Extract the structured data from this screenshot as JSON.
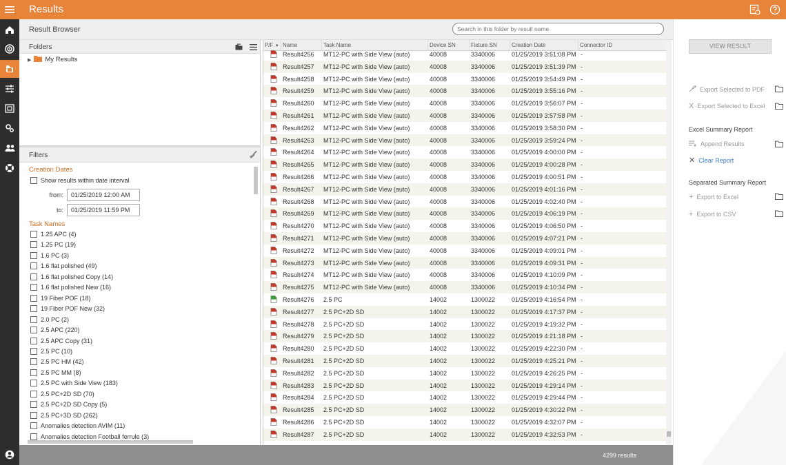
{
  "app": {
    "title": "Results"
  },
  "header": {
    "title": "Result Browser",
    "search_placeholder": "Search in this folder by result name"
  },
  "rail": {
    "icons": [
      "home-icon",
      "target-icon",
      "results-icon",
      "sliders-icon",
      "gallery-icon",
      "settings-icon",
      "users-icon",
      "help-ring-icon",
      "account-icon"
    ],
    "active": "results-icon"
  },
  "folders": {
    "title": "Folders",
    "tree": [
      {
        "label": "My Results"
      }
    ]
  },
  "filters": {
    "title": "Filters",
    "creation_dates": {
      "title": "Creation Dates",
      "interval_label": "Show results within date interval",
      "from_label": "from:",
      "from_value": "01/25/2019 12:00 AM",
      "to_label": "to:",
      "to_value": "01/25/2019 11:59 PM"
    },
    "task_names_title": "Task Names",
    "task_names": [
      "1.25 APC (4)",
      "1.25 PC (19)",
      "1.6 PC (3)",
      "1.6 flat polished (49)",
      "1.6 flat polished Copy (14)",
      "1.6 flat polished New (16)",
      "19 Fiber POF (18)",
      "19 Fiber POF New (32)",
      "2.0 PC (2)",
      "2.5 APC (220)",
      "2.5 APC Copy (31)",
      "2.5 PC (10)",
      "2.5 PC HM (42)",
      "2.5 PC MM (8)",
      "2.5 PC with Side View (183)",
      "2.5 PC+2D SD (70)",
      "2.5 PC+2D SD Copy (5)",
      "2.5 PC+3D SD (262)",
      "Anomalies detection AVIM (11)",
      "Anomalies detection Football ferrule (3)"
    ]
  },
  "table": {
    "columns": [
      "P/F",
      "Name",
      "Task Name",
      "Device SN",
      "Fixture SN",
      "Creation Date",
      "Connector ID"
    ],
    "rows": [
      {
        "status": "fail",
        "name": "Result4256",
        "task": "MT12-PC with Side View (auto)",
        "device": "40008",
        "fixture": "3340006",
        "date": "01/25/2019 3:51:08 PM",
        "connector": "-"
      },
      {
        "status": "fail",
        "name": "Result4257",
        "task": "MT12-PC with Side View (auto)",
        "device": "40008",
        "fixture": "3340006",
        "date": "01/25/2019 3:51:39 PM",
        "connector": "-"
      },
      {
        "status": "fail",
        "name": "Result4258",
        "task": "MT12-PC with Side View (auto)",
        "device": "40008",
        "fixture": "3340006",
        "date": "01/25/2019 3:54:49 PM",
        "connector": "-"
      },
      {
        "status": "fail",
        "name": "Result4259",
        "task": "MT12-PC with Side View (auto)",
        "device": "40008",
        "fixture": "3340006",
        "date": "01/25/2019 3:55:16 PM",
        "connector": "-"
      },
      {
        "status": "fail",
        "name": "Result4260",
        "task": "MT12-PC with Side View (auto)",
        "device": "40008",
        "fixture": "3340006",
        "date": "01/25/2019 3:56:07 PM",
        "connector": "-"
      },
      {
        "status": "fail",
        "name": "Result4261",
        "task": "MT12-PC with Side View (auto)",
        "device": "40008",
        "fixture": "3340006",
        "date": "01/25/2019 3:57:58 PM",
        "connector": "-"
      },
      {
        "status": "fail",
        "name": "Result4262",
        "task": "MT12-PC with Side View (auto)",
        "device": "40008",
        "fixture": "3340006",
        "date": "01/25/2019 3:58:30 PM",
        "connector": "-"
      },
      {
        "status": "fail",
        "name": "Result4263",
        "task": "MT12-PC with Side View (auto)",
        "device": "40008",
        "fixture": "3340006",
        "date": "01/25/2019 3:59:24 PM",
        "connector": "-"
      },
      {
        "status": "fail",
        "name": "Result4264",
        "task": "MT12-PC with Side View (auto)",
        "device": "40008",
        "fixture": "3340006",
        "date": "01/25/2019 4:00:00 PM",
        "connector": "-"
      },
      {
        "status": "fail",
        "name": "Result4265",
        "task": "MT12-PC with Side View (auto)",
        "device": "40008",
        "fixture": "3340006",
        "date": "01/25/2019 4:00:28 PM",
        "connector": "-"
      },
      {
        "status": "fail",
        "name": "Result4266",
        "task": "MT12-PC with Side View (auto)",
        "device": "40008",
        "fixture": "3340006",
        "date": "01/25/2019 4:00:51 PM",
        "connector": "-"
      },
      {
        "status": "fail",
        "name": "Result4267",
        "task": "MT12-PC with Side View (auto)",
        "device": "40008",
        "fixture": "3340006",
        "date": "01/25/2019 4:01:16 PM",
        "connector": "-"
      },
      {
        "status": "fail",
        "name": "Result4268",
        "task": "MT12-PC with Side View (auto)",
        "device": "40008",
        "fixture": "3340006",
        "date": "01/25/2019 4:02:40 PM",
        "connector": "-"
      },
      {
        "status": "fail",
        "name": "Result4269",
        "task": "MT12-PC with Side View (auto)",
        "device": "40008",
        "fixture": "3340006",
        "date": "01/25/2019 4:06:19 PM",
        "connector": "-"
      },
      {
        "status": "fail",
        "name": "Result4270",
        "task": "MT12-PC with Side View (auto)",
        "device": "40008",
        "fixture": "3340006",
        "date": "01/25/2019 4:06:50 PM",
        "connector": "-"
      },
      {
        "status": "fail",
        "name": "Result4271",
        "task": "MT12-PC with Side View (auto)",
        "device": "40008",
        "fixture": "3340006",
        "date": "01/25/2019 4:07:21 PM",
        "connector": "-"
      },
      {
        "status": "fail",
        "name": "Result4272",
        "task": "MT12-PC with Side View (auto)",
        "device": "40008",
        "fixture": "3340006",
        "date": "01/25/2019 4:09:01 PM",
        "connector": "-"
      },
      {
        "status": "fail",
        "name": "Result4273",
        "task": "MT12-PC with Side View (auto)",
        "device": "40008",
        "fixture": "3340006",
        "date": "01/25/2019 4:09:31 PM",
        "connector": "-"
      },
      {
        "status": "fail",
        "name": "Result4274",
        "task": "MT12-PC with Side View (auto)",
        "device": "40008",
        "fixture": "3340006",
        "date": "01/25/2019 4:10:09 PM",
        "connector": "-"
      },
      {
        "status": "fail",
        "name": "Result4275",
        "task": "MT12-PC with Side View (auto)",
        "device": "40008",
        "fixture": "3340006",
        "date": "01/25/2019 4:10:34 PM",
        "connector": "-"
      },
      {
        "status": "pass",
        "name": "Result4276",
        "task": "2.5 PC",
        "device": "14002",
        "fixture": "1300022",
        "date": "01/25/2019 4:16:54 PM",
        "connector": "-"
      },
      {
        "status": "fail",
        "name": "Result4277",
        "task": "2.5 PC+2D SD",
        "device": "14002",
        "fixture": "1300022",
        "date": "01/25/2019 4:17:37 PM",
        "connector": "-"
      },
      {
        "status": "fail",
        "name": "Result4278",
        "task": "2.5 PC+2D SD",
        "device": "14002",
        "fixture": "1300022",
        "date": "01/25/2019 4:19:32 PM",
        "connector": "-"
      },
      {
        "status": "fail",
        "name": "Result4279",
        "task": "2.5 PC+2D SD",
        "device": "14002",
        "fixture": "1300022",
        "date": "01/25/2019 4:21:18 PM",
        "connector": "-"
      },
      {
        "status": "fail",
        "name": "Result4280",
        "task": "2.5 PC+2D SD",
        "device": "14002",
        "fixture": "1300022",
        "date": "01/25/2019 4:22:30 PM",
        "connector": "-"
      },
      {
        "status": "fail",
        "name": "Result4281",
        "task": "2.5 PC+2D SD",
        "device": "14002",
        "fixture": "1300022",
        "date": "01/25/2019 4:25:21 PM",
        "connector": "-"
      },
      {
        "status": "fail",
        "name": "Result4282",
        "task": "2.5 PC+2D SD",
        "device": "14002",
        "fixture": "1300022",
        "date": "01/25/2019 4:26:25 PM",
        "connector": "-"
      },
      {
        "status": "fail",
        "name": "Result4283",
        "task": "2.5 PC+2D SD",
        "device": "14002",
        "fixture": "1300022",
        "date": "01/25/2019 4:29:14 PM",
        "connector": "-"
      },
      {
        "status": "fail",
        "name": "Result4284",
        "task": "2.5 PC+2D SD",
        "device": "14002",
        "fixture": "1300022",
        "date": "01/25/2019 4:29:44 PM",
        "connector": "-"
      },
      {
        "status": "fail",
        "name": "Result4285",
        "task": "2.5 PC+2D SD",
        "device": "14002",
        "fixture": "1300022",
        "date": "01/25/2019 4:30:22 PM",
        "connector": "-"
      },
      {
        "status": "fail",
        "name": "Result4286",
        "task": "2.5 PC+2D SD",
        "device": "14002",
        "fixture": "1300022",
        "date": "01/25/2019 4:32:07 PM",
        "connector": "-"
      },
      {
        "status": "fail",
        "name": "Result4287",
        "task": "2.5 PC+2D SD",
        "device": "14002",
        "fixture": "1300022",
        "date": "01/25/2019 4:32:53 PM",
        "connector": "-"
      }
    ]
  },
  "status": {
    "count": "4299 results"
  },
  "right_panel": {
    "view_result": "VIEW RESULT",
    "export_pdf": "Export Selected to PDF",
    "export_excel": "Export Selected to Excel",
    "excel_summary_title": "Excel Summary Report",
    "append_results": "Append Results",
    "clear_report": "Clear Report",
    "separated_summary_title": "Separated Summary Report",
    "export_to_excel": "Export to Excel",
    "export_to_csv": "Export to CSV"
  },
  "colors": {
    "accent": "#e8843a",
    "rail": "#2d2d2d",
    "section_title": "#d06a1f",
    "link": "#3d7dc9",
    "fail_icon": "#c0392b",
    "pass_icon": "#3a9a3a"
  }
}
